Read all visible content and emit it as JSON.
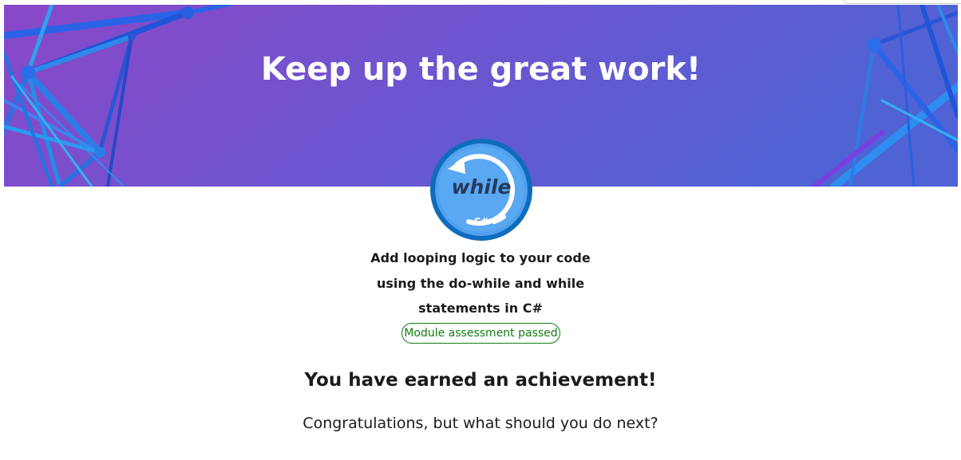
{
  "hero": {
    "title": "Keep up the great work!",
    "gradient_start": "#8a47c9",
    "gradient_end": "#4f63d4"
  },
  "badge": {
    "icon": "while-loop-badge-icon",
    "word": "while",
    "language": "‹C#›",
    "ring_color": "#0f6cbd",
    "fill_color": "#50a0f0"
  },
  "module": {
    "title": "Add looping logic to your code using the do-while and while statements in C#",
    "status": "Module assessment passed",
    "status_color": "#107c10"
  },
  "achievement": {
    "heading": "You have earned an achievement!",
    "next_prompt": "Congratulations, but what should you do next?"
  }
}
